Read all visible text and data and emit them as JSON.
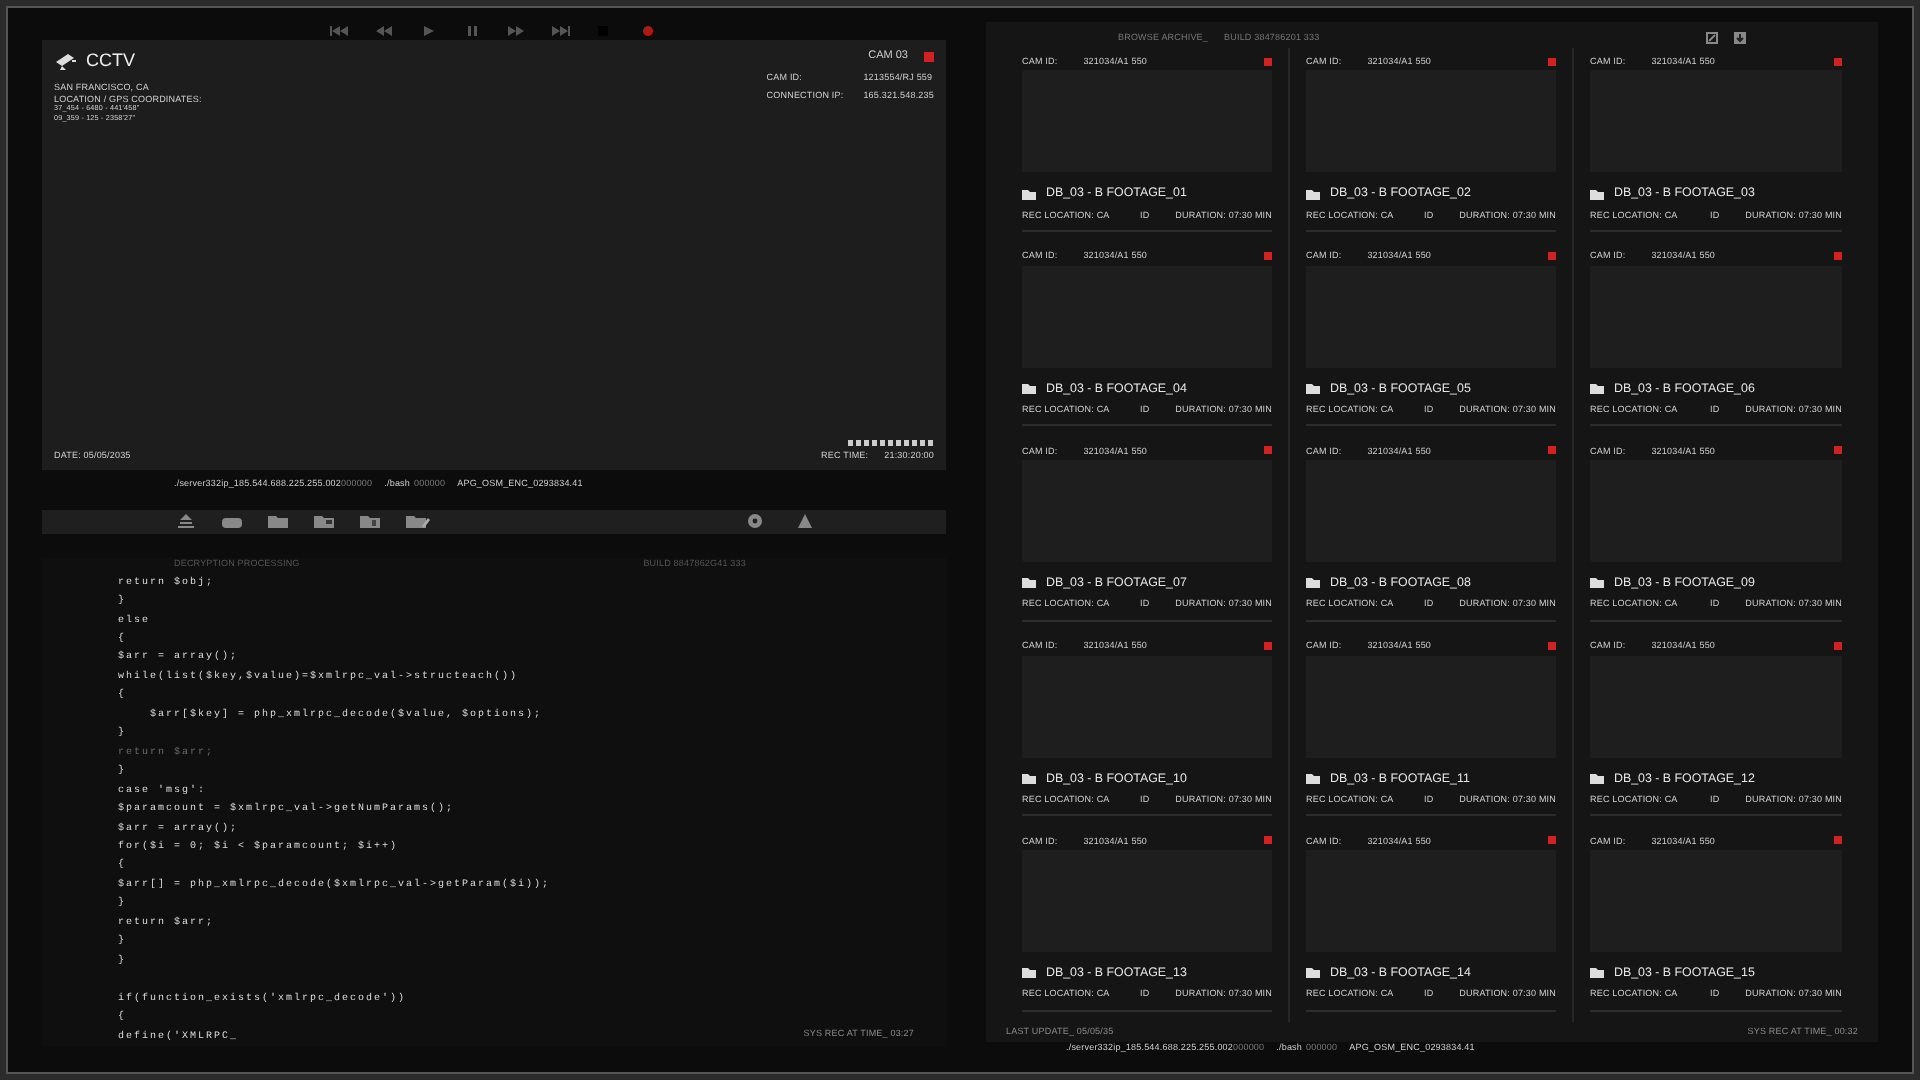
{
  "player": {
    "title": "CCTV",
    "camera": "CAM 03",
    "recording": true,
    "location": "SAN FRANCISCO, CA",
    "gps_label": "LOCATION / GPS COORDINATES:",
    "gps_lines": [
      "37_454 - 6480 - 441'458\"",
      "09_359 - 125 - 2358'27\""
    ],
    "info": [
      {
        "label": "CAM ID:",
        "value": "1213554/RJ 559"
      },
      {
        "label": "CONNECTION IP:",
        "value": "165.321.548.235"
      }
    ],
    "date": "DATE: 05/05/2035",
    "rec_time_label": "REC TIME:",
    "rec_time": "21:30:20:00"
  },
  "path": {
    "server": "./server332ip_185.544.688.225.255.002",
    "server_dim": "000000",
    "bash": "./bash",
    "bash_dim": "000000",
    "file": "APG_OSM_ENC_0293834.41"
  },
  "code_panel": {
    "title": "DECRYPTION PROCESSING",
    "build": "BUILD 8847862G41 333",
    "footer": "SYS REC AT TIME_ 03:27",
    "lines": [
      {
        "text": "return $obj;",
        "faded": false
      },
      {
        "text": "}",
        "faded": false
      },
      {
        "text": "else",
        "faded": false
      },
      {
        "text": "{",
        "faded": false
      },
      {
        "text": "$arr = array();",
        "faded": false
      },
      {
        "text": "while(list($key,$value)=$xmlrpc_val->structeach())",
        "faded": false
      },
      {
        "text": "{",
        "faded": false
      },
      {
        "text": "    $arr[$key] = php_xmlrpc_decode($value, $options);",
        "faded": false
      },
      {
        "text": "}",
        "faded": false
      },
      {
        "text": "return $arr;",
        "faded": true
      },
      {
        "text": "}",
        "faded": false
      },
      {
        "text": "case 'msg':",
        "faded": false
      },
      {
        "text": "$paramcount = $xmlrpc_val->getNumParams();",
        "faded": false
      },
      {
        "text": "$arr = array();",
        "faded": false
      },
      {
        "text": "for($i = 0; $i < $paramcount; $i++)",
        "faded": false
      },
      {
        "text": "{",
        "faded": false
      },
      {
        "text": "$arr[] = php_xmlrpc_decode($xmlrpc_val->getParam($i));",
        "faded": false
      },
      {
        "text": "}",
        "faded": false
      },
      {
        "text": "return $arr;",
        "faded": false
      },
      {
        "text": "}",
        "faded": false
      },
      {
        "text": "}",
        "faded": false
      },
      {
        "kind": "blank"
      },
      {
        "text": "if(function_exists('xmlrpc_decode'))",
        "faded": false
      },
      {
        "text": "{",
        "faded": false
      },
      {
        "text": "define('XMLRPC_",
        "faded": false
      }
    ]
  },
  "archive": {
    "title": "BROWSE ARCHIVE_",
    "build": "BUILD 384786201 333",
    "last_update": "LAST UPDATE_ 05/05/35",
    "footer": "SYS REC AT TIME_ 00:32",
    "path": {
      "server": "./server332ip_185.544.688.225.255.002",
      "server_dim": "000000",
      "bash": "./bash",
      "bash_dim": "000000",
      "file": "APG_OSM_ENC_0293834.41"
    },
    "tiles": [
      {
        "cam_label": "CAM ID:",
        "cam_id": "321034/A1 550",
        "recording": true,
        "title": "DB_03 - B FOOTAGE_01",
        "location": "REC LOCATION: CA",
        "id": "ID",
        "duration": "DURATION: 07:30 MIN"
      },
      {
        "cam_label": "CAM ID:",
        "cam_id": "321034/A1 550",
        "recording": true,
        "title": "DB_03 - B FOOTAGE_02",
        "location": "REC LOCATION: CA",
        "id": "ID",
        "duration": "DURATION: 07:30 MIN"
      },
      {
        "cam_label": "CAM ID:",
        "cam_id": "321034/A1 550",
        "recording": true,
        "title": "DB_03 - B FOOTAGE_03",
        "location": "REC LOCATION: CA",
        "id": "ID",
        "duration": "DURATION: 07:30 MIN"
      },
      {
        "cam_label": "CAM ID:",
        "cam_id": "321034/A1 550",
        "recording": true,
        "title": "DB_03 - B FOOTAGE_04",
        "location": "REC LOCATION: CA",
        "id": "ID",
        "duration": "DURATION: 07:30 MIN"
      },
      {
        "cam_label": "CAM ID:",
        "cam_id": "321034/A1 550",
        "recording": true,
        "title": "DB_03 - B FOOTAGE_05",
        "location": "REC LOCATION: CA",
        "id": "ID",
        "duration": "DURATION: 07:30 MIN"
      },
      {
        "cam_label": "CAM ID:",
        "cam_id": "321034/A1 550",
        "recording": true,
        "title": "DB_03 - B FOOTAGE_06",
        "location": "REC LOCATION: CA",
        "id": "ID",
        "duration": "DURATION: 07:30 MIN"
      },
      {
        "cam_label": "CAM ID:",
        "cam_id": "321034/A1 550",
        "recording": true,
        "title": "DB_03 - B FOOTAGE_07",
        "location": "REC LOCATION: CA",
        "id": "ID",
        "duration": "DURATION: 07:30 MIN"
      },
      {
        "cam_label": "CAM ID:",
        "cam_id": "321034/A1 550",
        "recording": true,
        "title": "DB_03 - B FOOTAGE_08",
        "location": "REC LOCATION: CA",
        "id": "ID",
        "duration": "DURATION: 07:30 MIN"
      },
      {
        "cam_label": "CAM ID:",
        "cam_id": "321034/A1 550",
        "recording": true,
        "title": "DB_03 - B FOOTAGE_09",
        "location": "REC LOCATION: CA",
        "id": "ID",
        "duration": "DURATION: 07:30 MIN"
      },
      {
        "cam_label": "CAM ID:",
        "cam_id": "321034/A1 550",
        "recording": true,
        "title": "DB_03 - B FOOTAGE_10",
        "location": "REC LOCATION: CA",
        "id": "ID",
        "duration": "DURATION: 07:30 MIN"
      },
      {
        "cam_label": "CAM ID:",
        "cam_id": "321034/A1 550",
        "recording": true,
        "title": "DB_03 - B FOOTAGE_11",
        "location": "REC LOCATION: CA",
        "id": "ID",
        "duration": "DURATION: 07:30 MIN"
      },
      {
        "cam_label": "CAM ID:",
        "cam_id": "321034/A1 550",
        "recording": true,
        "title": "DB_03 - B FOOTAGE_12",
        "location": "REC LOCATION: CA",
        "id": "ID",
        "duration": "DURATION: 07:30 MIN"
      },
      {
        "cam_label": "CAM ID:",
        "cam_id": "321034/A1 550",
        "recording": true,
        "title": "DB_03 - B FOOTAGE_13",
        "location": "REC LOCATION: CA",
        "id": "ID",
        "duration": "DURATION: 07:30 MIN"
      },
      {
        "cam_label": "CAM ID:",
        "cam_id": "321034/A1 550",
        "recording": true,
        "title": "DB_03 - B FOOTAGE_14",
        "location": "REC LOCATION: CA",
        "id": "ID",
        "duration": "DURATION: 07:30 MIN"
      },
      {
        "cam_label": "CAM ID:",
        "cam_id": "321034/A1 550",
        "recording": true,
        "title": "DB_03 - B FOOTAGE_15",
        "location": "REC LOCATION: CA",
        "id": "ID",
        "duration": "DURATION: 07:30 MIN"
      }
    ]
  }
}
